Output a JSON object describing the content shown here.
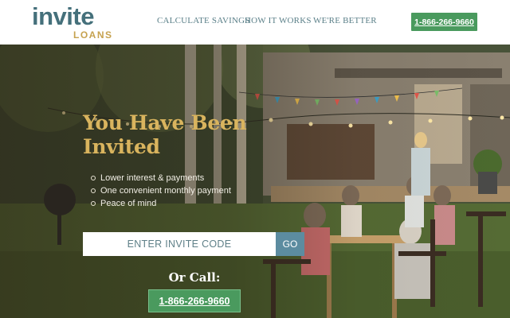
{
  "brand": {
    "logo_main": "invite",
    "logo_sub": "LOANS",
    "logo_main_color": "#45707b",
    "logo_sub_color": "#c6a24f"
  },
  "nav": {
    "items": [
      {
        "label": "CALCULATE SAVINGS"
      },
      {
        "label": "HOW IT WORKS"
      },
      {
        "label": "WE'RE BETTER"
      }
    ]
  },
  "header": {
    "phone_label": "1-866-266-9660"
  },
  "hero": {
    "title_line1": "You Have Been",
    "title_line2": "Invited",
    "bullets": [
      "Lower interest & payments",
      "One convenient monthly payment",
      "Peace of mind"
    ],
    "invite_placeholder": "ENTER INVITE CODE",
    "go_label": "GO",
    "or_call": "Or Call:",
    "phone_label": "1-866-266-9660"
  },
  "colors": {
    "accent_green": "#4a9a5e",
    "title_gold": "#d9b45e",
    "go_blue": "#5c8ca0"
  }
}
